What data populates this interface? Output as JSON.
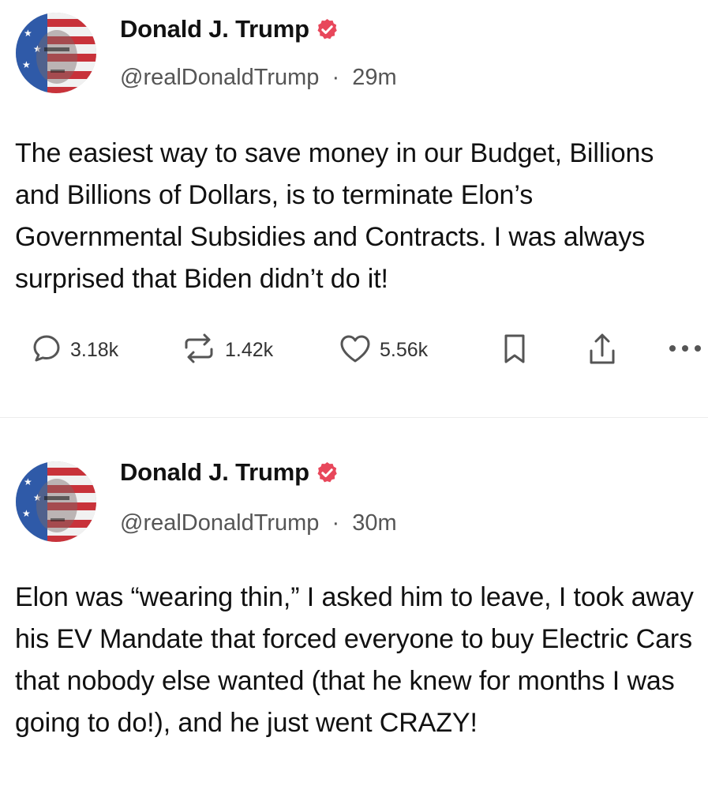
{
  "posts": [
    {
      "author": {
        "display_name": "Donald J. Trump",
        "handle": "@realDonaldTrump",
        "verified": true,
        "verified_color": "#e8475b"
      },
      "time_separator": "·",
      "time": "29m",
      "text": "The easiest way to save money in our Budget, Billions and Billions of Dollars, is to terminate Elon’s Governmental Subsidies and Contracts. I was always surprised that Biden didn’t do it!",
      "stats": {
        "replies": "3.18k",
        "reposts": "1.42k",
        "likes": "5.56k"
      },
      "action_icons": [
        "reply-icon",
        "repost-icon",
        "like-icon",
        "bookmark-icon",
        "share-icon",
        "more-icon"
      ]
    },
    {
      "author": {
        "display_name": "Donald J. Trump",
        "handle": "@realDonaldTrump",
        "verified": true,
        "verified_color": "#e8475b"
      },
      "time_separator": "·",
      "time": "30m",
      "text": "Elon was “wearing thin,” I asked him to leave, I took away his EV Mandate that forced everyone to buy Electric Cars that nobody else wanted (that he knew for months I was going to do!), and he just went CRAZY!"
    }
  ]
}
